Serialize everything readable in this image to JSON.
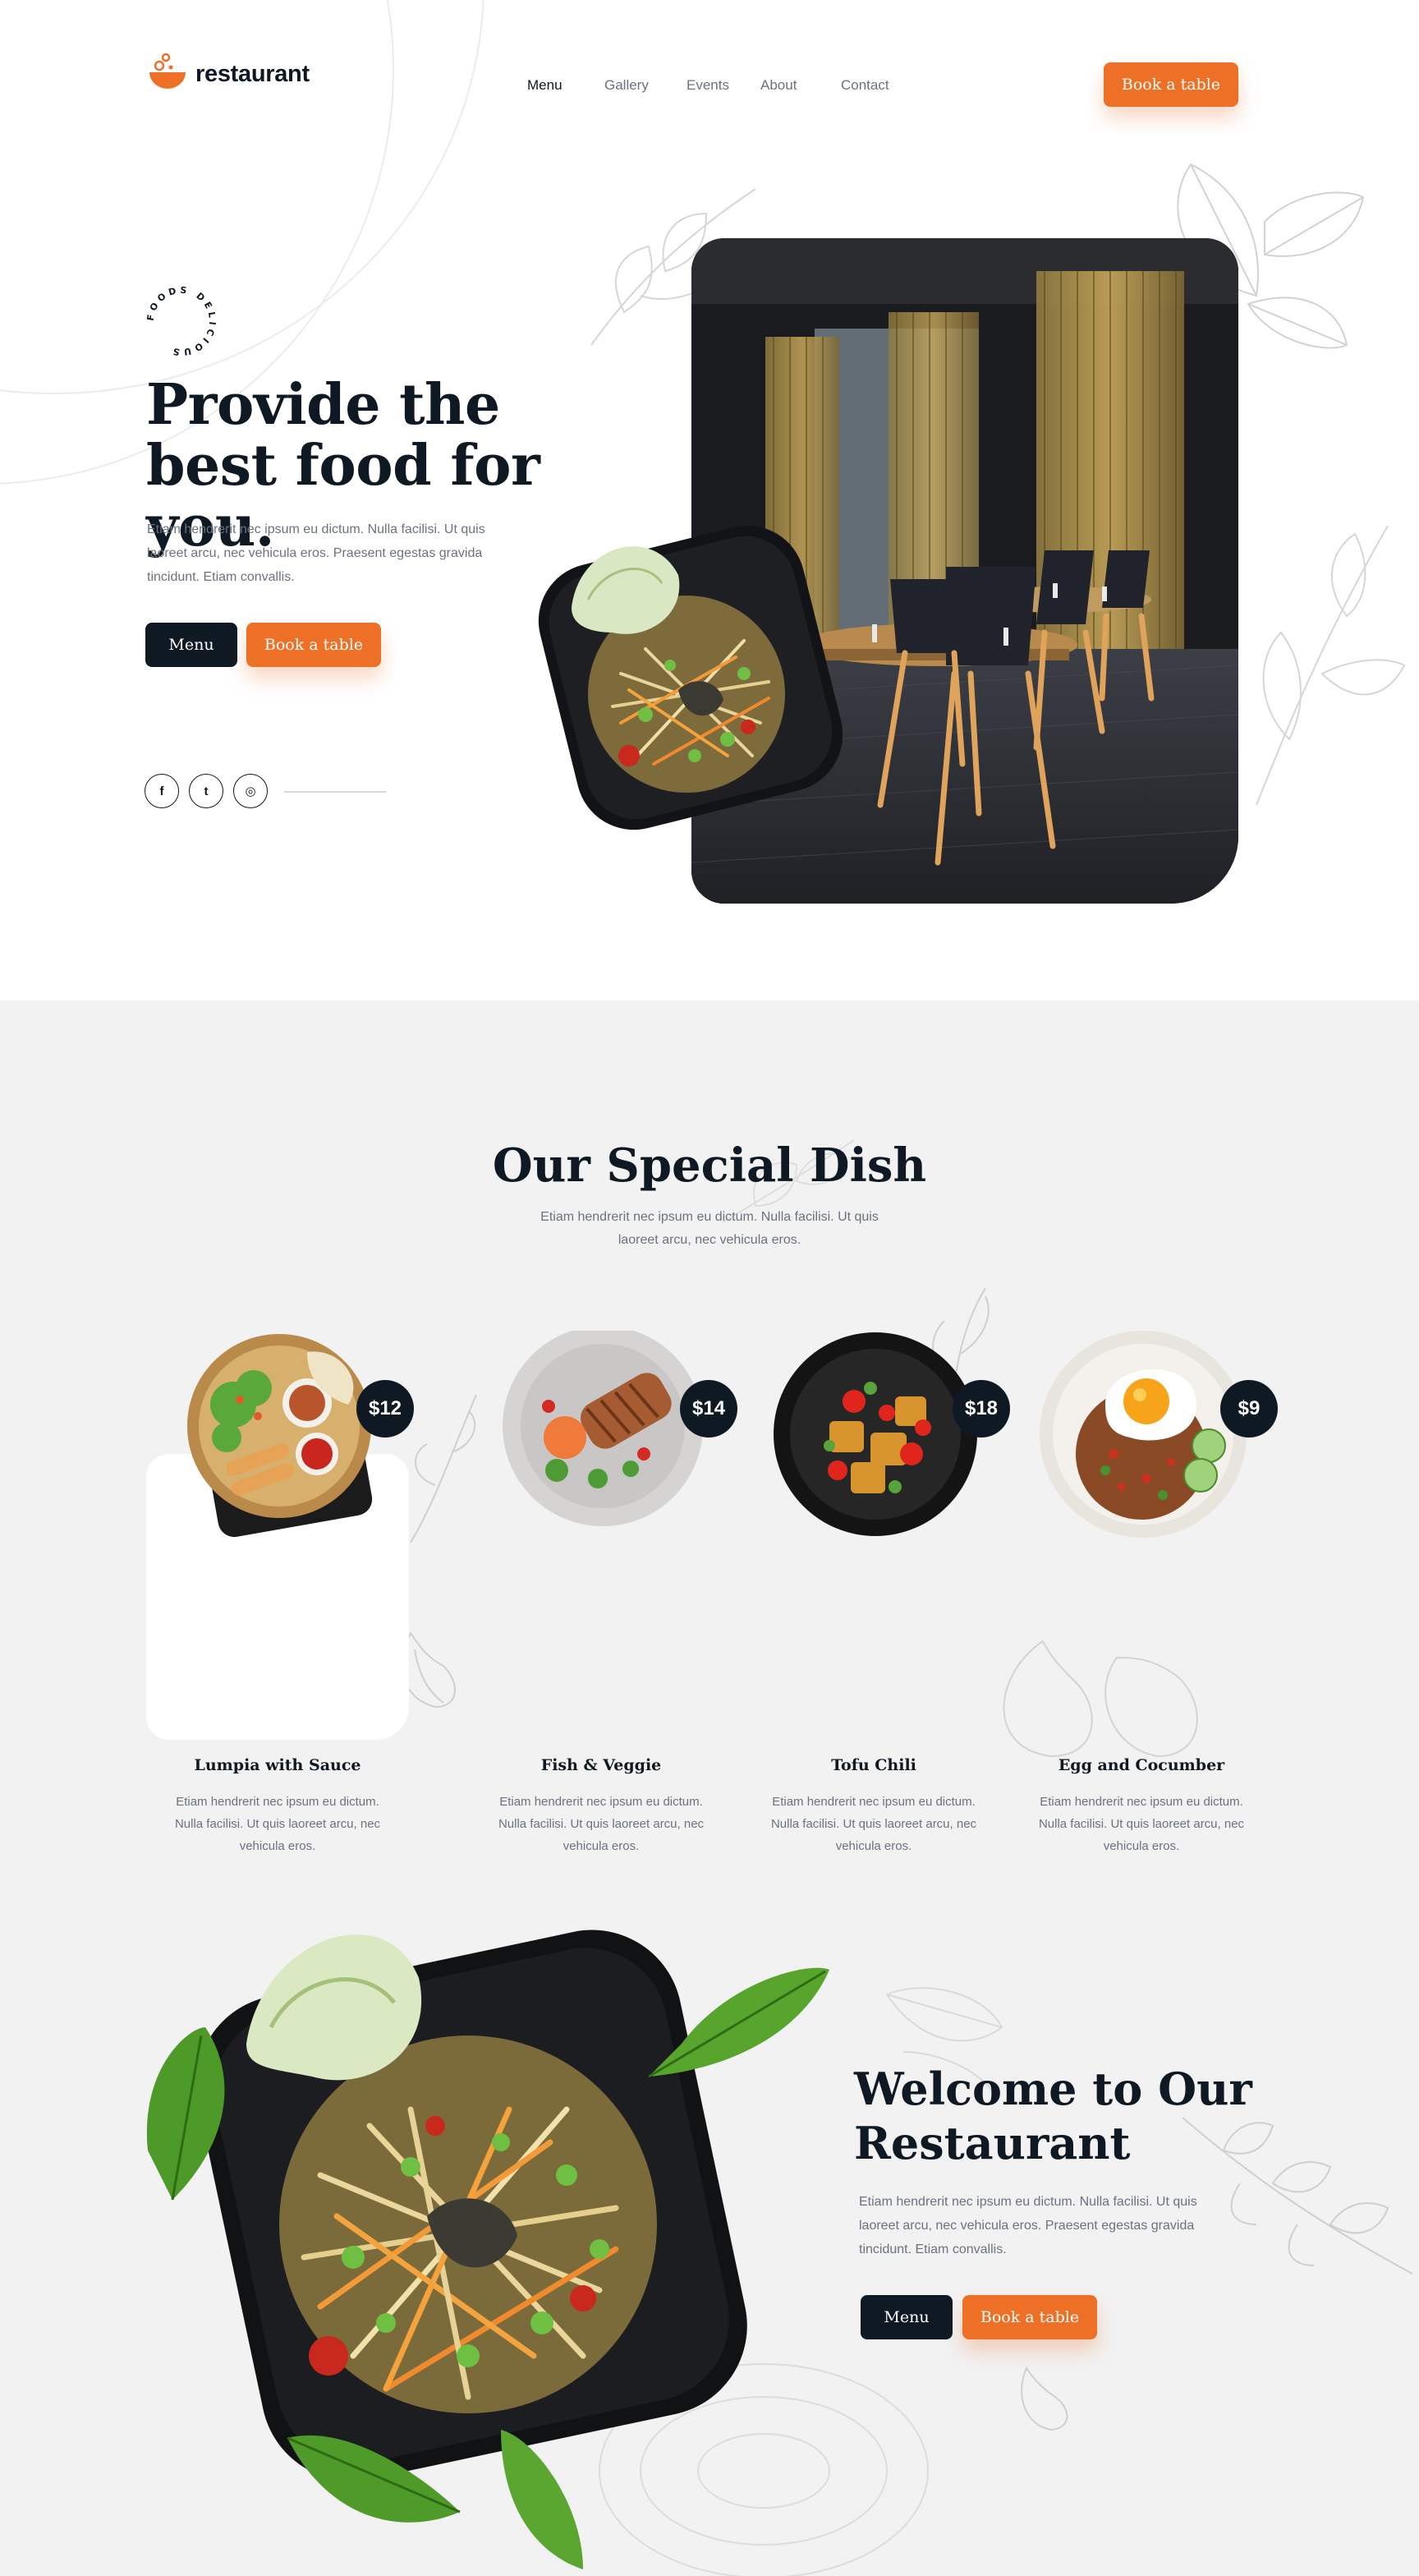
{
  "brand": {
    "name": "restaurant",
    "accent": "#ee7026",
    "dark": "#0f1923"
  },
  "nav": {
    "items": [
      {
        "label": "Menu",
        "active": true
      },
      {
        "label": "Gallery",
        "active": false
      },
      {
        "label": "Events",
        "active": false
      },
      {
        "label": "About",
        "active": false
      },
      {
        "label": "Contact",
        "active": false
      }
    ],
    "cta": "Book a table"
  },
  "hero": {
    "badge_text": "FOODS DELICIOUS",
    "title": "Provide the best food for you.",
    "description": "Etiam hendrerit nec ipsum eu dictum. Nulla facilisi. Ut quis laoreet arcu, nec vehicula eros. Praesent egestas gravida tincidunt. Etiam convallis.",
    "menu_button": "Menu",
    "book_button": "Book a table",
    "socials": [
      {
        "icon": "facebook-icon",
        "glyph": "f"
      },
      {
        "icon": "twitter-icon",
        "glyph": "t"
      },
      {
        "icon": "instagram-icon",
        "glyph": "◎"
      }
    ]
  },
  "special": {
    "title": "Our Special Dish",
    "description": "Etiam hendrerit nec ipsum eu dictum. Nulla facilisi. Ut quis laoreet arcu, nec vehicula eros.",
    "dishes": [
      {
        "name": "Lumpia with Sauce",
        "price": "$12",
        "description": "Etiam hendrerit nec ipsum eu dictum. Nulla facilisi. Ut quis laoreet arcu, nec vehicula eros."
      },
      {
        "name": "Fish & Veggie",
        "price": "$14",
        "description": "Etiam hendrerit nec ipsum eu dictum. Nulla facilisi. Ut quis laoreet arcu, nec vehicula eros."
      },
      {
        "name": "Tofu Chili",
        "price": "$18",
        "description": "Etiam hendrerit nec ipsum eu dictum. Nulla facilisi. Ut quis laoreet arcu, nec vehicula eros."
      },
      {
        "name": "Egg and Cocumber",
        "price": "$9",
        "description": "Etiam hendrerit nec ipsum eu dictum. Nulla facilisi. Ut quis laoreet arcu, nec vehicula eros."
      }
    ]
  },
  "welcome": {
    "title": "Welcome to Our Restaurant",
    "description": "Etiam hendrerit nec ipsum eu dictum. Nulla facilisi. Ut quis laoreet arcu, nec vehicula eros. Praesent egestas gravida tincidunt. Etiam convallis.",
    "menu_button": "Menu",
    "book_button": "Book a table"
  }
}
